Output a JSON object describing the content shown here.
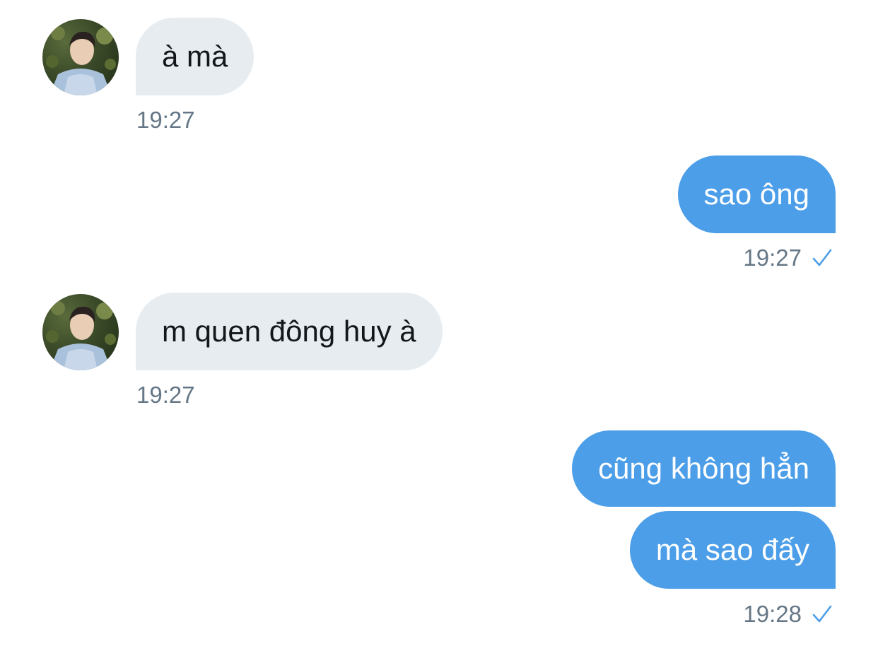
{
  "messages": [
    {
      "direction": "incoming",
      "text": "à mà",
      "time": "19:27"
    },
    {
      "direction": "outgoing",
      "text": "sao ông",
      "time": "19:27",
      "status": "sent-check-icon"
    },
    {
      "direction": "incoming",
      "text": "m quen đông huy à",
      "time": "19:27"
    },
    {
      "direction": "outgoing",
      "text": "cũng không hẳn"
    },
    {
      "direction": "outgoing",
      "text": "mà sao đấy",
      "time": "19:28",
      "status": "sent-check-icon"
    }
  ],
  "colors": {
    "incoming_bubble": "#e6ecf0",
    "outgoing_bubble": "#4c9ee8",
    "timestamp": "#657786",
    "check": "#4c9ee8"
  }
}
